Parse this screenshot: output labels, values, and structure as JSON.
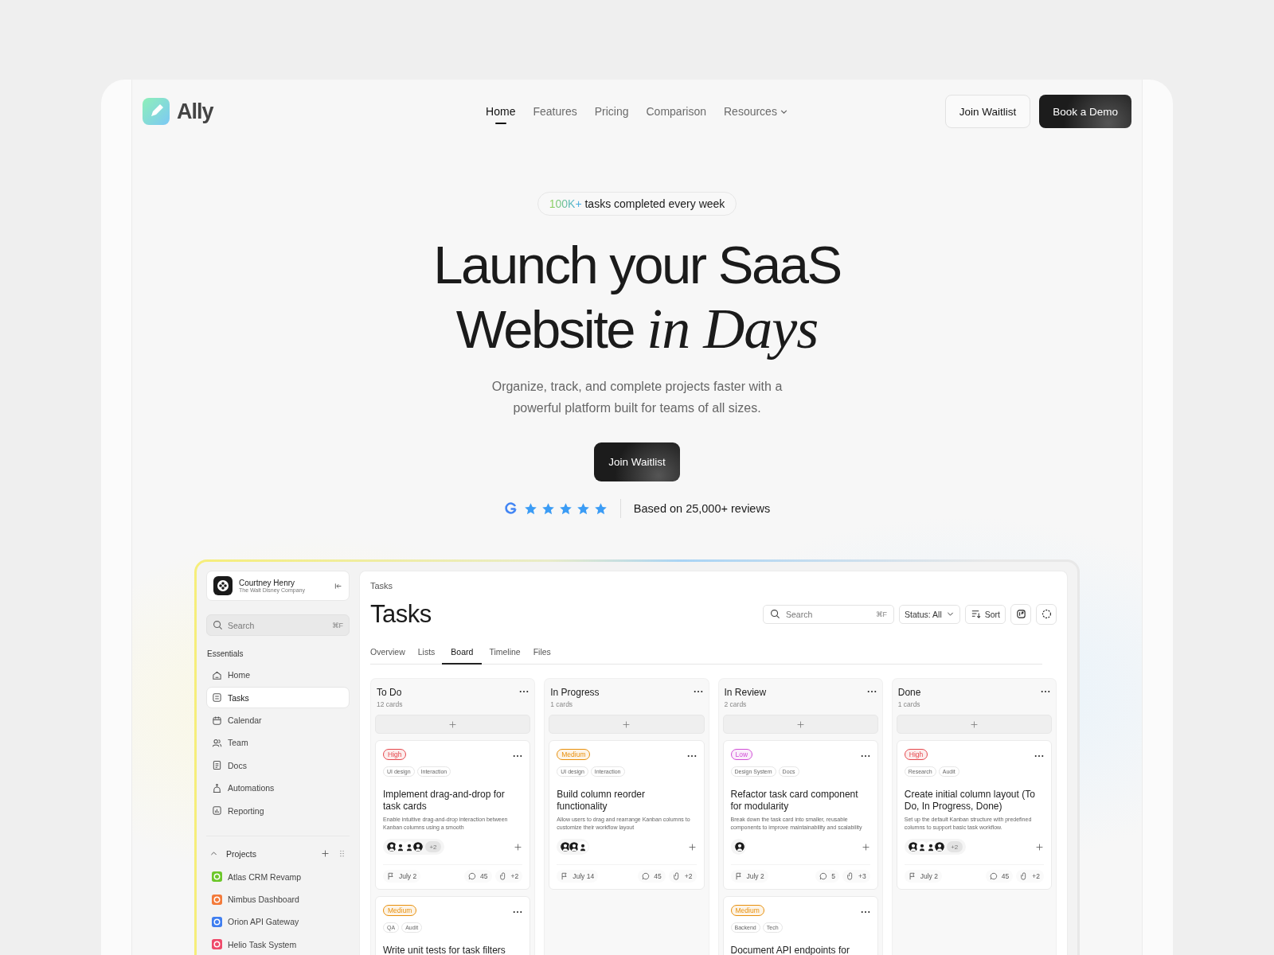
{
  "nav": {
    "logo": "Ally",
    "links": [
      {
        "label": "Home",
        "selected": true
      },
      {
        "label": "Features",
        "selected": false
      },
      {
        "label": "Pricing",
        "selected": false
      },
      {
        "label": "Comparison",
        "selected": false
      },
      {
        "label": "Resources",
        "selected": false,
        "kind": "dropdown"
      }
    ],
    "secondary_button": "Join Waitlist",
    "primary_button": "Book a Demo"
  },
  "hero": {
    "badge": {
      "highlight": "100K+",
      "text": "tasks completed every week"
    },
    "title_lines": [
      "Launch your SaaS",
      "Website *in Days*"
    ],
    "subtitle_lines": [
      "Organize, track, and complete projects faster with a",
      "powerful platform built for teams of all sizes."
    ],
    "cta": "Join Waitlist",
    "rating": {
      "stars": 5,
      "text": "Based on 25,000+ reviews"
    }
  },
  "app": {
    "user": {
      "name": "Courtney Henry",
      "company": "The Walt Disney Company"
    },
    "search": {
      "placeholder": "Search",
      "shortcut": "⌘F"
    },
    "essentials": {
      "title": "Essentials",
      "items": [
        {
          "label": "Home",
          "selected": false
        },
        {
          "label": "Tasks",
          "selected": true
        },
        {
          "label": "Calendar",
          "selected": false
        },
        {
          "label": "Team",
          "selected": false
        },
        {
          "label": "Docs",
          "selected": false
        },
        {
          "label": "Automations",
          "selected": false
        },
        {
          "label": "Reporting",
          "selected": false
        }
      ]
    },
    "projects": {
      "title": "Projects",
      "expanded": true,
      "items": [
        {
          "label": "Atlas CRM Revamp",
          "color": "#6cc72a"
        },
        {
          "label": "Nimbus Dashboard",
          "color": "#f37a3a"
        },
        {
          "label": "Orion API Gateway",
          "color": "#3f7ef0"
        },
        {
          "label": "Helio Task System",
          "color": "#ef4a6a"
        }
      ]
    },
    "main": {
      "breadcrumb": "Tasks",
      "title": "Tasks",
      "search": {
        "placeholder": "Search",
        "shortcut": "⌘F"
      },
      "status_filter": "Status: All",
      "sort": "Sort",
      "tabs": [
        {
          "label": "Overview",
          "selected": false
        },
        {
          "label": "Lists",
          "selected": false
        },
        {
          "label": "Board",
          "selected": true
        },
        {
          "label": "Timeline",
          "selected": false
        },
        {
          "label": "Files",
          "selected": false
        }
      ],
      "columns": [
        {
          "title": "To Do",
          "count": "12 cards",
          "cards": [
            {
              "priority": {
                "label": "High",
                "color": "#e5484d"
              },
              "tags": [
                "UI design",
                "Interaction"
              ],
              "title": "Implement drag-and-drop for task cards",
              "description": "Enable intuitive drag-and-drop interaction between Kanban columns using a smooth",
              "avatars": [
                {
                  "kind": "dark"
                },
                {
                  "kind": "light"
                },
                {
                  "kind": "light"
                },
                {
                  "kind": "dark"
                }
              ],
              "extra": "+2",
              "date": "July 2",
              "comments": "45",
              "attachments": "+2"
            },
            {
              "priority": {
                "label": "Medium",
                "color": "#e8900c"
              },
              "tags": [
                "QA",
                "Audit"
              ],
              "title": "Write unit tests for task filters"
            }
          ]
        },
        {
          "title": "In Progress",
          "count": "1 cards",
          "cards": [
            {
              "priority": {
                "label": "Medium",
                "color": "#e8900c"
              },
              "tags": [
                "UI design",
                "Interaction"
              ],
              "title": "Build column reorder functionality",
              "description": "Allow users to drag and rearrange Kanban columns to customize their workflow layout",
              "avatars": [
                {
                  "kind": "dark"
                },
                {
                  "kind": "dark"
                },
                {
                  "kind": "light"
                }
              ],
              "date": "July 14",
              "comments": "45",
              "attachments": "+2"
            }
          ]
        },
        {
          "title": "In Review",
          "count": "2 cards",
          "cards": [
            {
              "priority": {
                "label": "Low",
                "color": "#d14fd6"
              },
              "tags": [
                "Design System",
                "Docs"
              ],
              "title": "Refactor task card component for modularity",
              "description": "Break down the task card into smaller, reusable components to improve maintainability and scalability",
              "avatars": [
                {
                  "kind": "dark"
                }
              ],
              "date": "July 2",
              "comments": "5",
              "attachments": "+3"
            },
            {
              "priority": {
                "label": "Medium",
                "color": "#e8900c"
              },
              "tags": [
                "Backend",
                "Tech"
              ],
              "title": "Document API endpoints for"
            }
          ]
        },
        {
          "title": "Done",
          "count": "1 cards",
          "cards": [
            {
              "priority": {
                "label": "High",
                "color": "#e5484d"
              },
              "tags": [
                "Research",
                "Audit"
              ],
              "title": "Create initial column layout (To Do, In Progress, Done)",
              "description": "Set up the default Kanban structure with predefined columns to support basic task workflow.",
              "avatars": [
                {
                  "kind": "dark"
                },
                {
                  "kind": "light"
                },
                {
                  "kind": "light"
                },
                {
                  "kind": "dark"
                }
              ],
              "extra": "+2",
              "date": "July 2",
              "comments": "45",
              "attachments": "+2"
            }
          ]
        }
      ]
    }
  }
}
